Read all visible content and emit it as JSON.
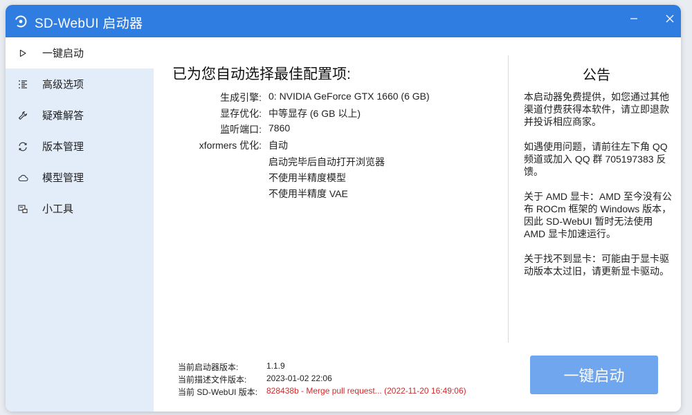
{
  "app": {
    "title": "SD-WebUI 启动器"
  },
  "sidebar": {
    "items": [
      {
        "label": "一键启动",
        "icon": "play-icon"
      },
      {
        "label": "高级选项",
        "icon": "list-icon"
      },
      {
        "label": "疑难解答",
        "icon": "wrench-icon"
      },
      {
        "label": "版本管理",
        "icon": "refresh-icon"
      },
      {
        "label": "模型管理",
        "icon": "cloud-icon"
      },
      {
        "label": "小工具",
        "icon": "tools-icon"
      }
    ],
    "social": [
      "globe-icon",
      "bilibili-icon",
      "qq-penguin-icon",
      "telegram-icon"
    ]
  },
  "main": {
    "heading": "已为您自动选择最佳配置项:",
    "config": [
      {
        "key": "生成引擎:",
        "value": "0: NVIDIA GeForce GTX 1660 (6 GB)"
      },
      {
        "key": "显存优化:",
        "value": "中等显存 (6 GB 以上)"
      },
      {
        "key": "监听端口:",
        "value": "7860"
      },
      {
        "key": "xformers 优化:",
        "value": "自动"
      },
      {
        "key": "",
        "value": "启动完毕后自动打开浏览器"
      },
      {
        "key": "",
        "value": "不使用半精度模型"
      },
      {
        "key": "",
        "value": "不使用半精度 VAE"
      }
    ],
    "version": {
      "launcher_label": "当前启动器版本:",
      "launcher_value": "1.1.9",
      "desc_label": "当前描述文件版本:",
      "desc_value": "2023-01-02 22:06",
      "webui_label": "当前 SD-WebUI 版本:",
      "webui_value": "828438b - Merge pull request... (2022-11-20 16:49:06)"
    },
    "launch_button": "一键启动"
  },
  "notice": {
    "title": "公告",
    "paragraphs": [
      "本启动器免费提供，如您通过其他渠道付费获得本软件，请立即退款并投诉相应商家。",
      "如遇使用问题，请前往左下角 QQ 频道或加入 QQ 群 705197383 反馈。",
      "关于 AMD 显卡：AMD 至今没有公布 ROCm 框架的 Windows 版本，因此 SD-WebUI 暂时无法使用 AMD 显卡加速运行。",
      "关于找不到显卡：可能由于显卡驱动版本太过旧，请更新显卡驱动。"
    ]
  },
  "colors": {
    "titlebar": "#2f7de1",
    "sidebar": "#e3edfa",
    "launch_button": "#6fa6ee",
    "warning_text": "#d12b2b"
  }
}
